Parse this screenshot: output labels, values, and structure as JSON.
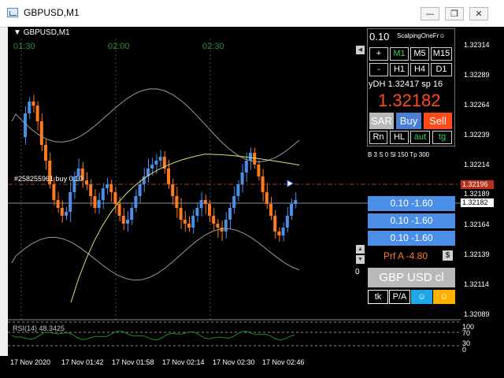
{
  "window": {
    "title": "GBPUSD,M1"
  },
  "chart": {
    "symbol_label": "GBPUSD,M1",
    "time_labels": [
      "01:30",
      "02:00",
      "02:30"
    ],
    "order_label": "#258255961 buy 0.10",
    "rsi_label": "RSI(14) 48.3425",
    "price_ticks": [
      "1.32314",
      "1.32289",
      "1.32264",
      "1.32239",
      "1.32214",
      "1.32189",
      "1.32164",
      "1.32139",
      "1.32114",
      "1.32089"
    ],
    "price_marker_order": "1.32196",
    "price_marker_current": "1.32182",
    "rsi_ticks": [
      "100",
      "70",
      "30",
      "0"
    ],
    "time_ticks": [
      "17 Nov 2020",
      "17 Nov 01:42",
      "17 Nov 01:58",
      "17 Nov 02:14",
      "17 Nov 02:30",
      "17 Nov 02:46"
    ]
  },
  "panel": {
    "lot": "0.10",
    "name": "ScalpingOneFr☺",
    "row1": [
      "+",
      "M1",
      "M5",
      "M15"
    ],
    "row2": [
      "-",
      "H1",
      "H4",
      "D1"
    ],
    "ydh": "yDH 1.32417 sp 16",
    "price": "1.32182",
    "sar": "SAR",
    "buy": "Buy",
    "sell": "Sell",
    "row3": [
      "Rn",
      "HL",
      "aut",
      "tg"
    ],
    "info": "B 3   S 0 Sl 150 Tp 300",
    "lots": [
      "0.10 -1.60",
      "0.10 -1.60",
      "0.10 -1.60"
    ],
    "profit": "Prf A  -4.80",
    "dollar": "$",
    "zero": "0",
    "symbol_close": "GBP USD cl",
    "tk": "tk",
    "pa": "P/A",
    "icon1": "person-icon",
    "icon2": "person-icon",
    "colors": {
      "buy": "#4a7fd4",
      "sell": "#ff4a1c",
      "up": "#4a90e8",
      "down": "#ff7a1c",
      "price": "#ff4a1c"
    }
  }
}
